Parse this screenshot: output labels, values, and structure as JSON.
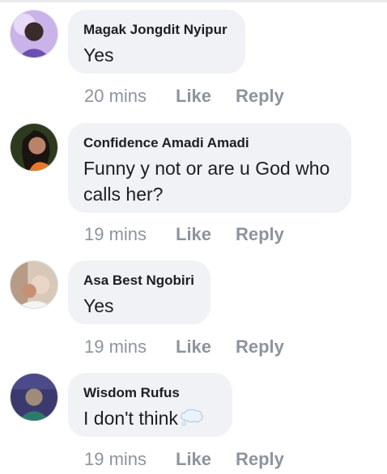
{
  "comments": [
    {
      "author": "Magak Jongdit Nyipur",
      "text": "Yes",
      "time": "20 mins",
      "like_label": "Like",
      "reply_label": "Reply"
    },
    {
      "author": "Confidence Amadi Amadi",
      "text": "Funny y not or are u God who calls her?",
      "time": "19 mins",
      "like_label": "Like",
      "reply_label": "Reply"
    },
    {
      "author": "Asa Best Ngobiri",
      "text": "Yes",
      "time": "19 mins",
      "like_label": "Like",
      "reply_label": "Reply"
    },
    {
      "author": "Wisdom Rufus",
      "text": "I don't think",
      "emoji": "thought-balloon-icon",
      "time": "19 mins",
      "like_label": "Like",
      "reply_label": "Reply"
    }
  ],
  "colors": {
    "bubble": "#f0f2f5",
    "text": "#1c1e21",
    "meta": "#8d949e"
  }
}
